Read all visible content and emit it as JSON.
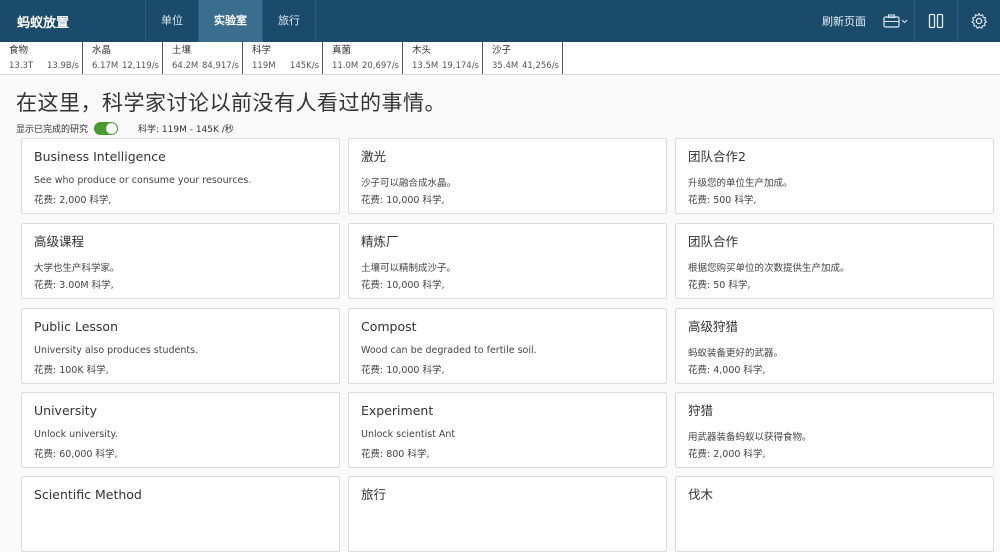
{
  "app": {
    "title": "蚂蚁放置"
  },
  "nav": {
    "tabs": [
      {
        "label": "单位"
      },
      {
        "label": "实验室"
      },
      {
        "label": "旅行"
      }
    ]
  },
  "header_right": {
    "refresh_label": "刷新页面"
  },
  "resources": [
    {
      "name": "食物",
      "amount": "13.3T",
      "rate": "13.9B/s"
    },
    {
      "name": "水晶",
      "amount": "6.17M",
      "rate": "12,119/s"
    },
    {
      "name": "土壤",
      "amount": "64.2M",
      "rate": "84,917/s"
    },
    {
      "name": "科学",
      "amount": "119M",
      "rate": "145K/s"
    },
    {
      "name": "真菌",
      "amount": "11.0M",
      "rate": "20,697/s"
    },
    {
      "name": "木头",
      "amount": "13.5M",
      "rate": "19,174/s"
    },
    {
      "name": "沙子",
      "amount": "35.4M",
      "rate": "41,256/s"
    }
  ],
  "main": {
    "heading": "在这里，科学家讨论以前没有人看过的事情。",
    "show_completed_label": "显示已完成的研究",
    "show_completed_on": true,
    "science_info": "科学: 119M - 145K /秒"
  },
  "cards": [
    {
      "title": "Business Intelligence",
      "desc": "See who produce or consume your resources.",
      "cost": "花费: 2,000 科学,"
    },
    {
      "title": "激光",
      "desc": "沙子可以融合成水晶。",
      "cost": "花费: 10,000 科学,"
    },
    {
      "title": "团队合作2",
      "desc": "升级您的单位生产加成。",
      "cost": "花费: 500 科学,"
    },
    {
      "title": "高级课程",
      "desc": "大学也生产科学家。",
      "cost": "花费: 3.00M 科学,"
    },
    {
      "title": "精炼厂",
      "desc": "土壤可以精制成沙子。",
      "cost": "花费: 10,000 科学,"
    },
    {
      "title": "团队合作",
      "desc": "根据您购买单位的次数提供生产加成。",
      "cost": "花费: 50 科学,"
    },
    {
      "title": "Public Lesson",
      "desc": "University also produces students.",
      "cost": "花费: 100K 科学,"
    },
    {
      "title": "Compost",
      "desc": "Wood can be degraded to fertile soil.",
      "cost": "花费: 10,000 科学,"
    },
    {
      "title": "高级狩猎",
      "desc": "蚂蚁装备更好的武器。",
      "cost": "花费: 4,000 科学,"
    },
    {
      "title": "University",
      "desc": "Unlock university.",
      "cost": "花费: 60,000 科学,"
    },
    {
      "title": "Experiment",
      "desc": "Unlock scientist Ant",
      "cost": "花费: 800 科学,"
    },
    {
      "title": "狩猎",
      "desc": "用武器装备蚂蚁以获得食物。",
      "cost": "花费: 2,000 科学,"
    },
    {
      "title": "Scientific Method",
      "desc": "",
      "cost": ""
    },
    {
      "title": "旅行",
      "desc": "",
      "cost": ""
    },
    {
      "title": "伐木",
      "desc": "",
      "cost": ""
    }
  ]
}
